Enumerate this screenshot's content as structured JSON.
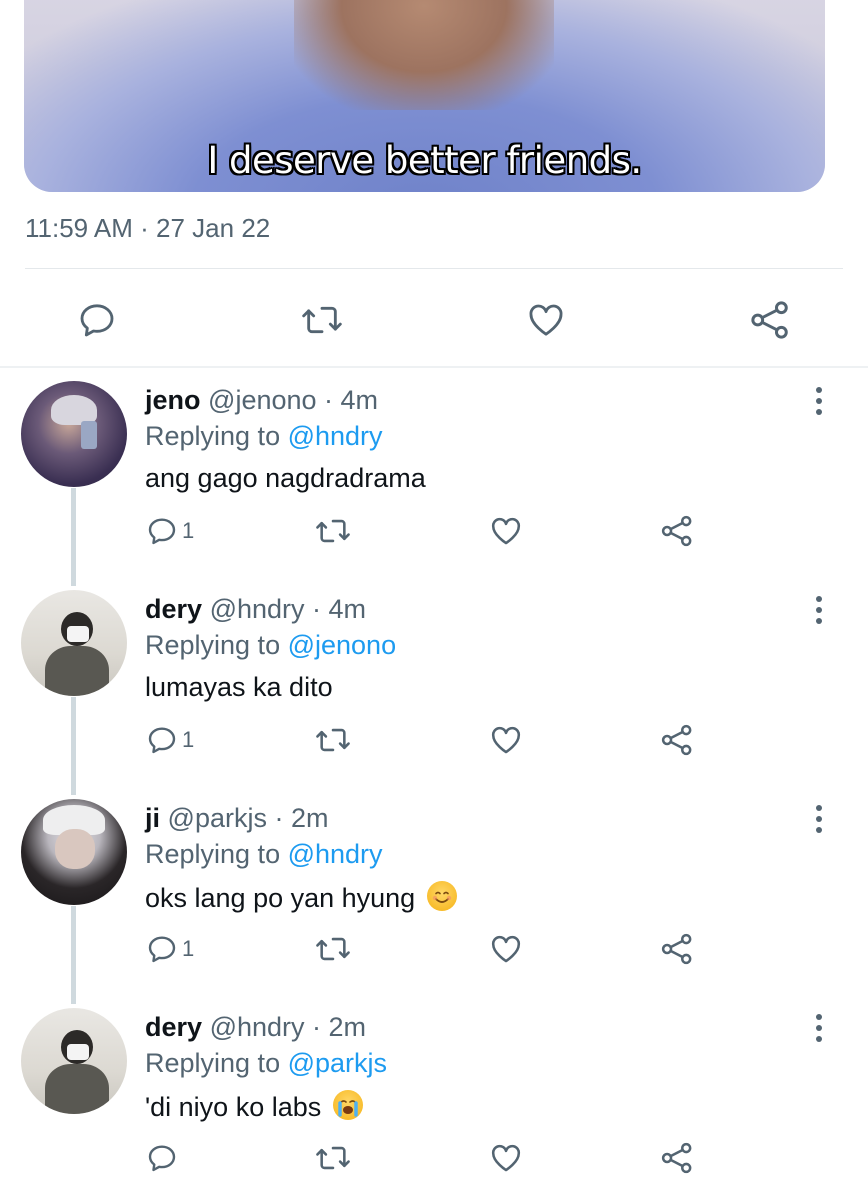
{
  "media": {
    "caption": "I deserve better friends."
  },
  "tweet": {
    "timestamp": "11:59 AM · 27 Jan 22"
  },
  "main_actions": [
    "reply-icon",
    "retweet-icon",
    "like-icon",
    "share-icon"
  ],
  "replies": [
    {
      "name": "jeno",
      "handle": "@jenono · 4m",
      "replying_prefix": "Replying to ",
      "replying_to": "@hndry",
      "text": "ang gago nagdradrama",
      "emoji": "",
      "reply_count": "1"
    },
    {
      "name": "dery",
      "handle": "@hndry · 4m",
      "replying_prefix": "Replying to ",
      "replying_to": "@jenono",
      "text": "lumayas ka dito",
      "emoji": "",
      "reply_count": "1"
    },
    {
      "name": "ji",
      "handle": "@parkjs · 2m",
      "replying_prefix": "Replying to ",
      "replying_to": "@hndry",
      "text": "oks lang po yan hyung",
      "emoji": "smiling-face-emoji",
      "reply_count": "1"
    },
    {
      "name": "dery",
      "handle": "@hndry · 2m",
      "replying_prefix": "Replying to ",
      "replying_to": "@parkjs",
      "text": "'di niyo ko labs",
      "emoji": "loudly-crying-face-emoji",
      "reply_count": ""
    }
  ],
  "colors": {
    "accent": "#1d9bf0",
    "muted": "#536471",
    "text": "#0f1419"
  }
}
